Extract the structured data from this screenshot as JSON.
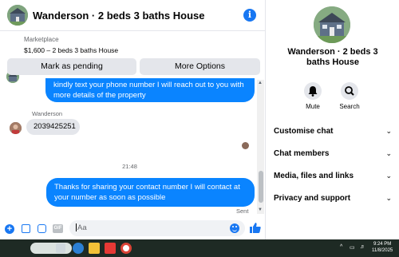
{
  "chat": {
    "title": "Wanderson · 2 beds 3 baths House",
    "marketplace": {
      "label": "Marketplace",
      "listing": "$1,600 – 2 beds 3 baths House"
    },
    "buttons": {
      "pending": "Mark as pending",
      "more": "More Options"
    },
    "messages": {
      "outgoing_1": "kindly text your phone number I will reach out to you with more details of the property",
      "sender": "Wanderson",
      "incoming_1": "2039425251",
      "timestamp": "21:48",
      "outgoing_2": "Thanks for sharing your contact number I will contact at your number as soon as possible",
      "status": "Sent"
    },
    "composer": {
      "placeholder": "Aa"
    }
  },
  "panel": {
    "title_line1": "Wanderson · 2 beds 3",
    "title_line2": "baths House",
    "actions": {
      "mute": "Mute",
      "search": "Search"
    },
    "sections": [
      "Customise chat",
      "Chat members",
      "Media, files and links",
      "Privacy and support"
    ]
  },
  "taskbar": {
    "time": "9:24 PM",
    "date": "11/8/2025"
  },
  "colors": {
    "accent": "#1877f2",
    "outgoing_bubble": "#0a84ff",
    "incoming_bubble": "#e4e6eb"
  }
}
